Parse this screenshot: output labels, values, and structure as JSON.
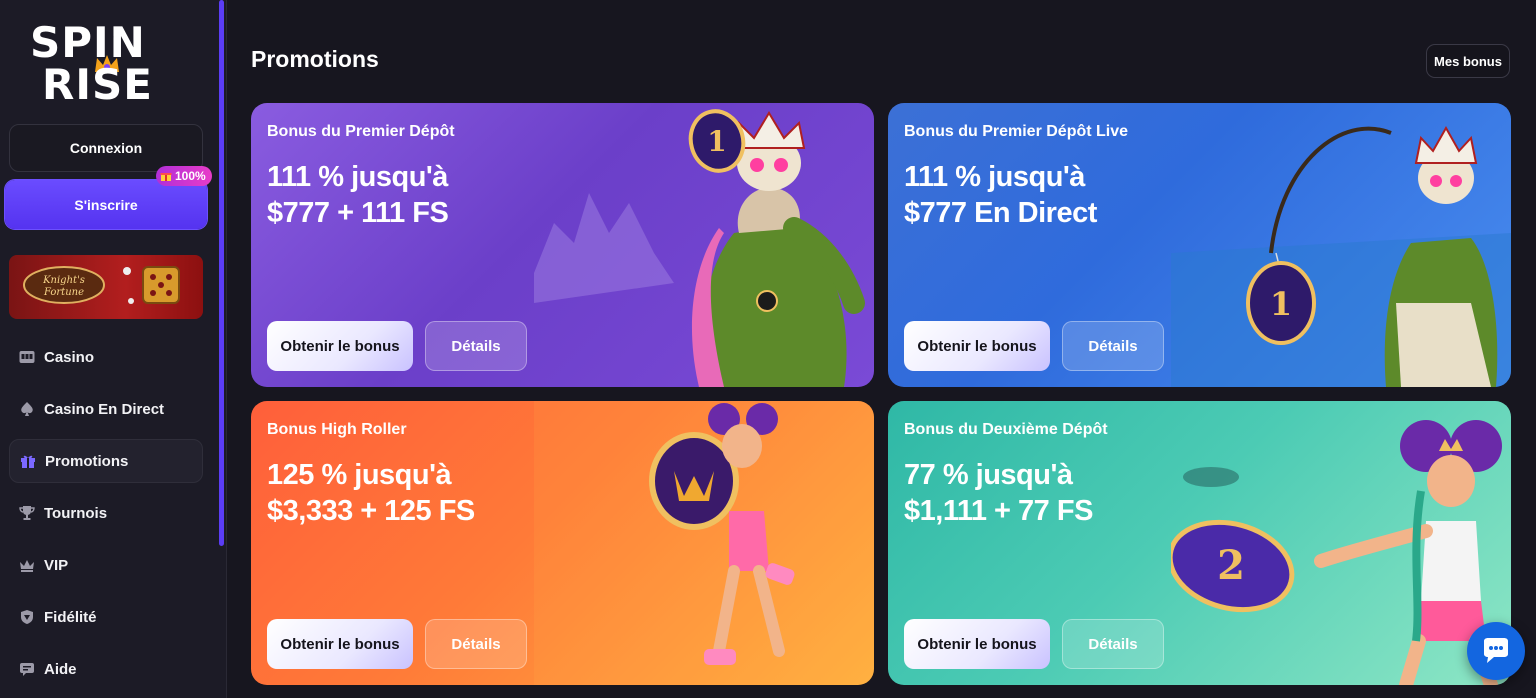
{
  "brand": {
    "logo_top": "SPIN",
    "logo_bottom": "RISE"
  },
  "auth": {
    "login_label": "Connexion",
    "signup_label": "S'inscrire",
    "signup_badge": "100%"
  },
  "banner": {
    "caption": "Knight's Fortune"
  },
  "nav": [
    {
      "label": "Casino",
      "icon": "slot-machine-icon"
    },
    {
      "label": "Casino En Direct",
      "icon": "spade-icon"
    },
    {
      "label": "Promotions",
      "icon": "gift-icon",
      "active": true
    },
    {
      "label": "Tournois",
      "icon": "trophy-icon"
    },
    {
      "label": "VIP",
      "icon": "crown-icon"
    },
    {
      "label": "Fidélité",
      "icon": "shield-icon"
    },
    {
      "label": "Aide",
      "icon": "chat-icon"
    }
  ],
  "main": {
    "title": "Promotions",
    "my_bonus_label": "Mes bonus"
  },
  "promotions": [
    {
      "title": "Bonus du Premier Dépôt",
      "offer_line1": "111 % jusqu'à",
      "offer_line2": "$777 + 111 FS",
      "cta": "Obtenir le bonus",
      "details": "Détails",
      "chip": "1"
    },
    {
      "title": "Bonus du Premier Dépôt Live",
      "offer_line1": "111 % jusqu'à",
      "offer_line2": "$777 En Direct",
      "cta": "Obtenir le bonus",
      "details": "Détails",
      "chip": "1"
    },
    {
      "title": "Bonus High Roller",
      "offer_line1": "125 % jusqu'à",
      "offer_line2": "$3,333 + 125 FS",
      "cta": "Obtenir le bonus",
      "details": "Détails",
      "chip": ""
    },
    {
      "title": "Bonus du Deuxième Dépôt",
      "offer_line1": "77 % jusqu'à",
      "offer_line2": "$1,111 + 77 FS",
      "cta": "Obtenir le bonus",
      "details": "Détails",
      "chip": "2"
    }
  ],
  "colors": {
    "accent": "#5b3df5",
    "sidebar_bg": "#1c1b26",
    "page_bg": "#17161f",
    "chat": "#1366e0"
  }
}
